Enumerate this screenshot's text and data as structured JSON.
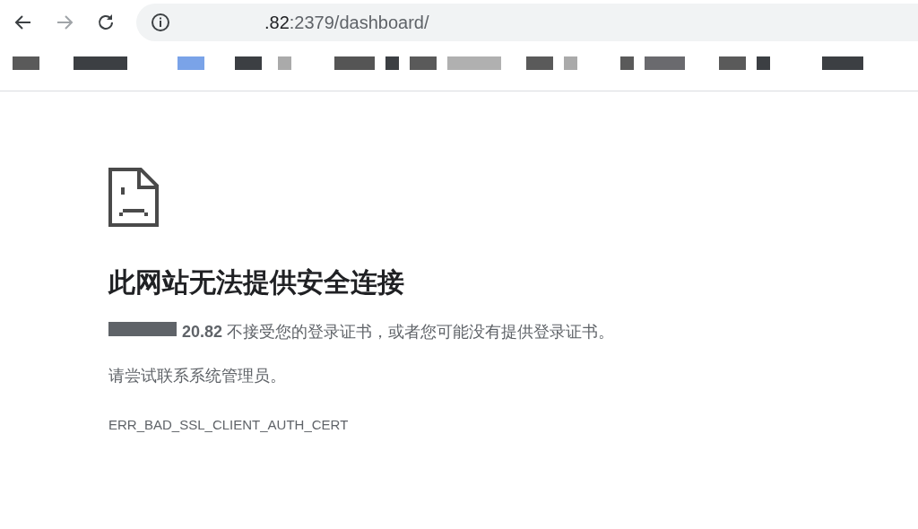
{
  "toolbar": {
    "url": {
      "host": ".82",
      "path": ":2379/dashboard/"
    }
  },
  "error_page": {
    "title": "此网站无法提供安全连接",
    "message": {
      "host": "20.82",
      "text": " 不接受您的登录证书，或者您可能没有提供登录证书。"
    },
    "suggestion": "请尝试联系系统管理员。",
    "error_code": "ERR_BAD_SSL_CLIENT_AUTH_CERT"
  }
}
